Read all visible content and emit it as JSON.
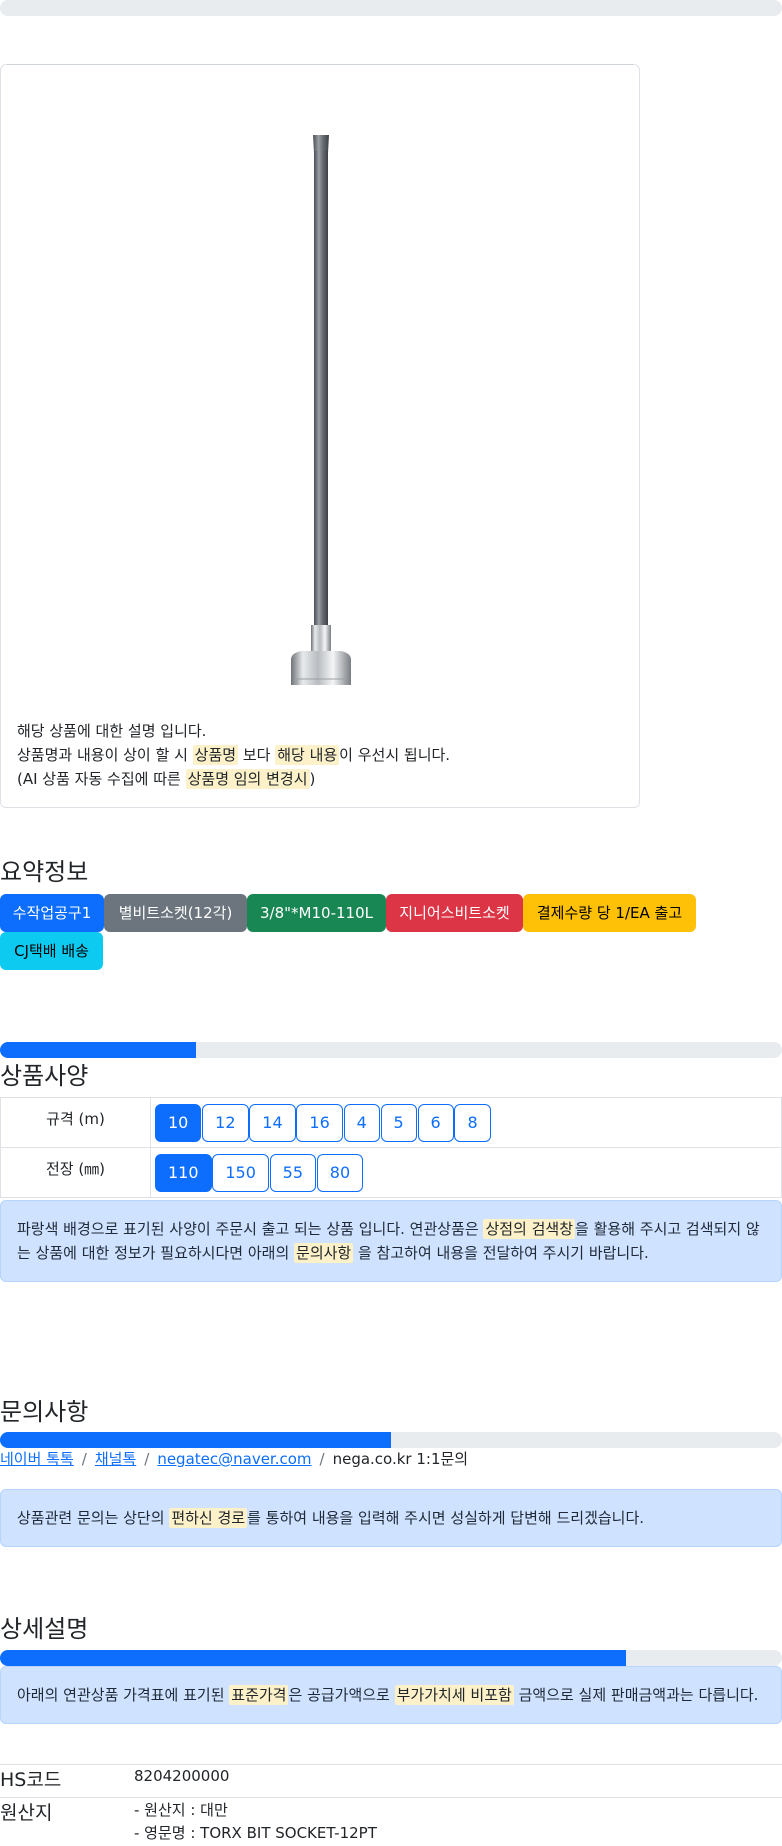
{
  "top_progress": {
    "value": 0
  },
  "product": {
    "description_lines": {
      "line1": "해당 상품에 대한 설명 입니다.",
      "line2_a": "상품명과 내용이 상이 할 시 ",
      "line2_mark1": "상품명",
      "line2_b": " 보다 ",
      "line2_mark2": "해당 내용",
      "line2_c": "이 우선시 됩니다.",
      "line3_a": "(AI 상품 자동 수집에 따른 ",
      "line3_mark": "상품명 임의 변경시",
      "line3_b": ")"
    }
  },
  "summary": {
    "title": "요약정보",
    "badges": [
      {
        "label": "수작업공구1",
        "color": "#0d6efd"
      },
      {
        "label": "별비트소켓(12각)",
        "color": "#6c757d"
      },
      {
        "label": "3/8\"*M10-110L",
        "color": "#198754"
      },
      {
        "label": "지니어스비트소켓",
        "color": "#dc3545"
      },
      {
        "label": "결제수량 당 1/EA 출고",
        "color": "#ffc107"
      },
      {
        "label": "CJ택배 배송",
        "color": "#0dcaf0"
      }
    ]
  },
  "spec": {
    "progress": 0.25,
    "title": "상품사양",
    "rows": [
      {
        "label": "규격 (m)",
        "options": [
          "10",
          "12",
          "14",
          "16",
          "4",
          "5",
          "6",
          "8"
        ],
        "selected": "10"
      },
      {
        "label": "전장 (㎜)",
        "options": [
          "110",
          "150",
          "55",
          "80"
        ],
        "selected": "110"
      }
    ],
    "notice": {
      "a": "파랑색 배경으로 표기된 사양이 주문시 출고 되는 상품 입니다. 연관상품은 ",
      "mark1": "상점의 검색창",
      "b": "을 활용해 주시고 검색되지 않",
      "c": "는 상품에 대한 정보가 필요하시다면 아래의 ",
      "mark2": "문의사항",
      "d": " 을 참고하여 내용을 전달하여 주시기 바랍니다."
    }
  },
  "inquiry": {
    "title": "문의사항",
    "progress": 0.5,
    "links": [
      "네이버 톡톡",
      "채널톡",
      "negatec@naver.com"
    ],
    "plain": "nega.co.kr 1:1문의",
    "notice": {
      "a": "상품관련 문의는 상단의 ",
      "mark": "편하신 경로",
      "b": "를 통하여 내용을 입력해 주시면 성실하게 답변해 드리겠습니다."
    }
  },
  "detail": {
    "title": "상세설명",
    "progress": 0.8,
    "notice": {
      "a": "아래의 연관상품 가격표에 표기된 ",
      "mark1": "표준가격",
      "b": "은 공급가액으로 ",
      "mark2": "부가가치세 비포함",
      "c": " 금액으로 실제 판매금액과는 다릅니다."
    },
    "hs_label": "HS코드",
    "hs_value": "8204200000",
    "origin_label": "원산지",
    "origin_line1": "- 원산지 : 대만",
    "origin_line2": "- 영문명 : TORX BIT SOCKET-12PT"
  }
}
